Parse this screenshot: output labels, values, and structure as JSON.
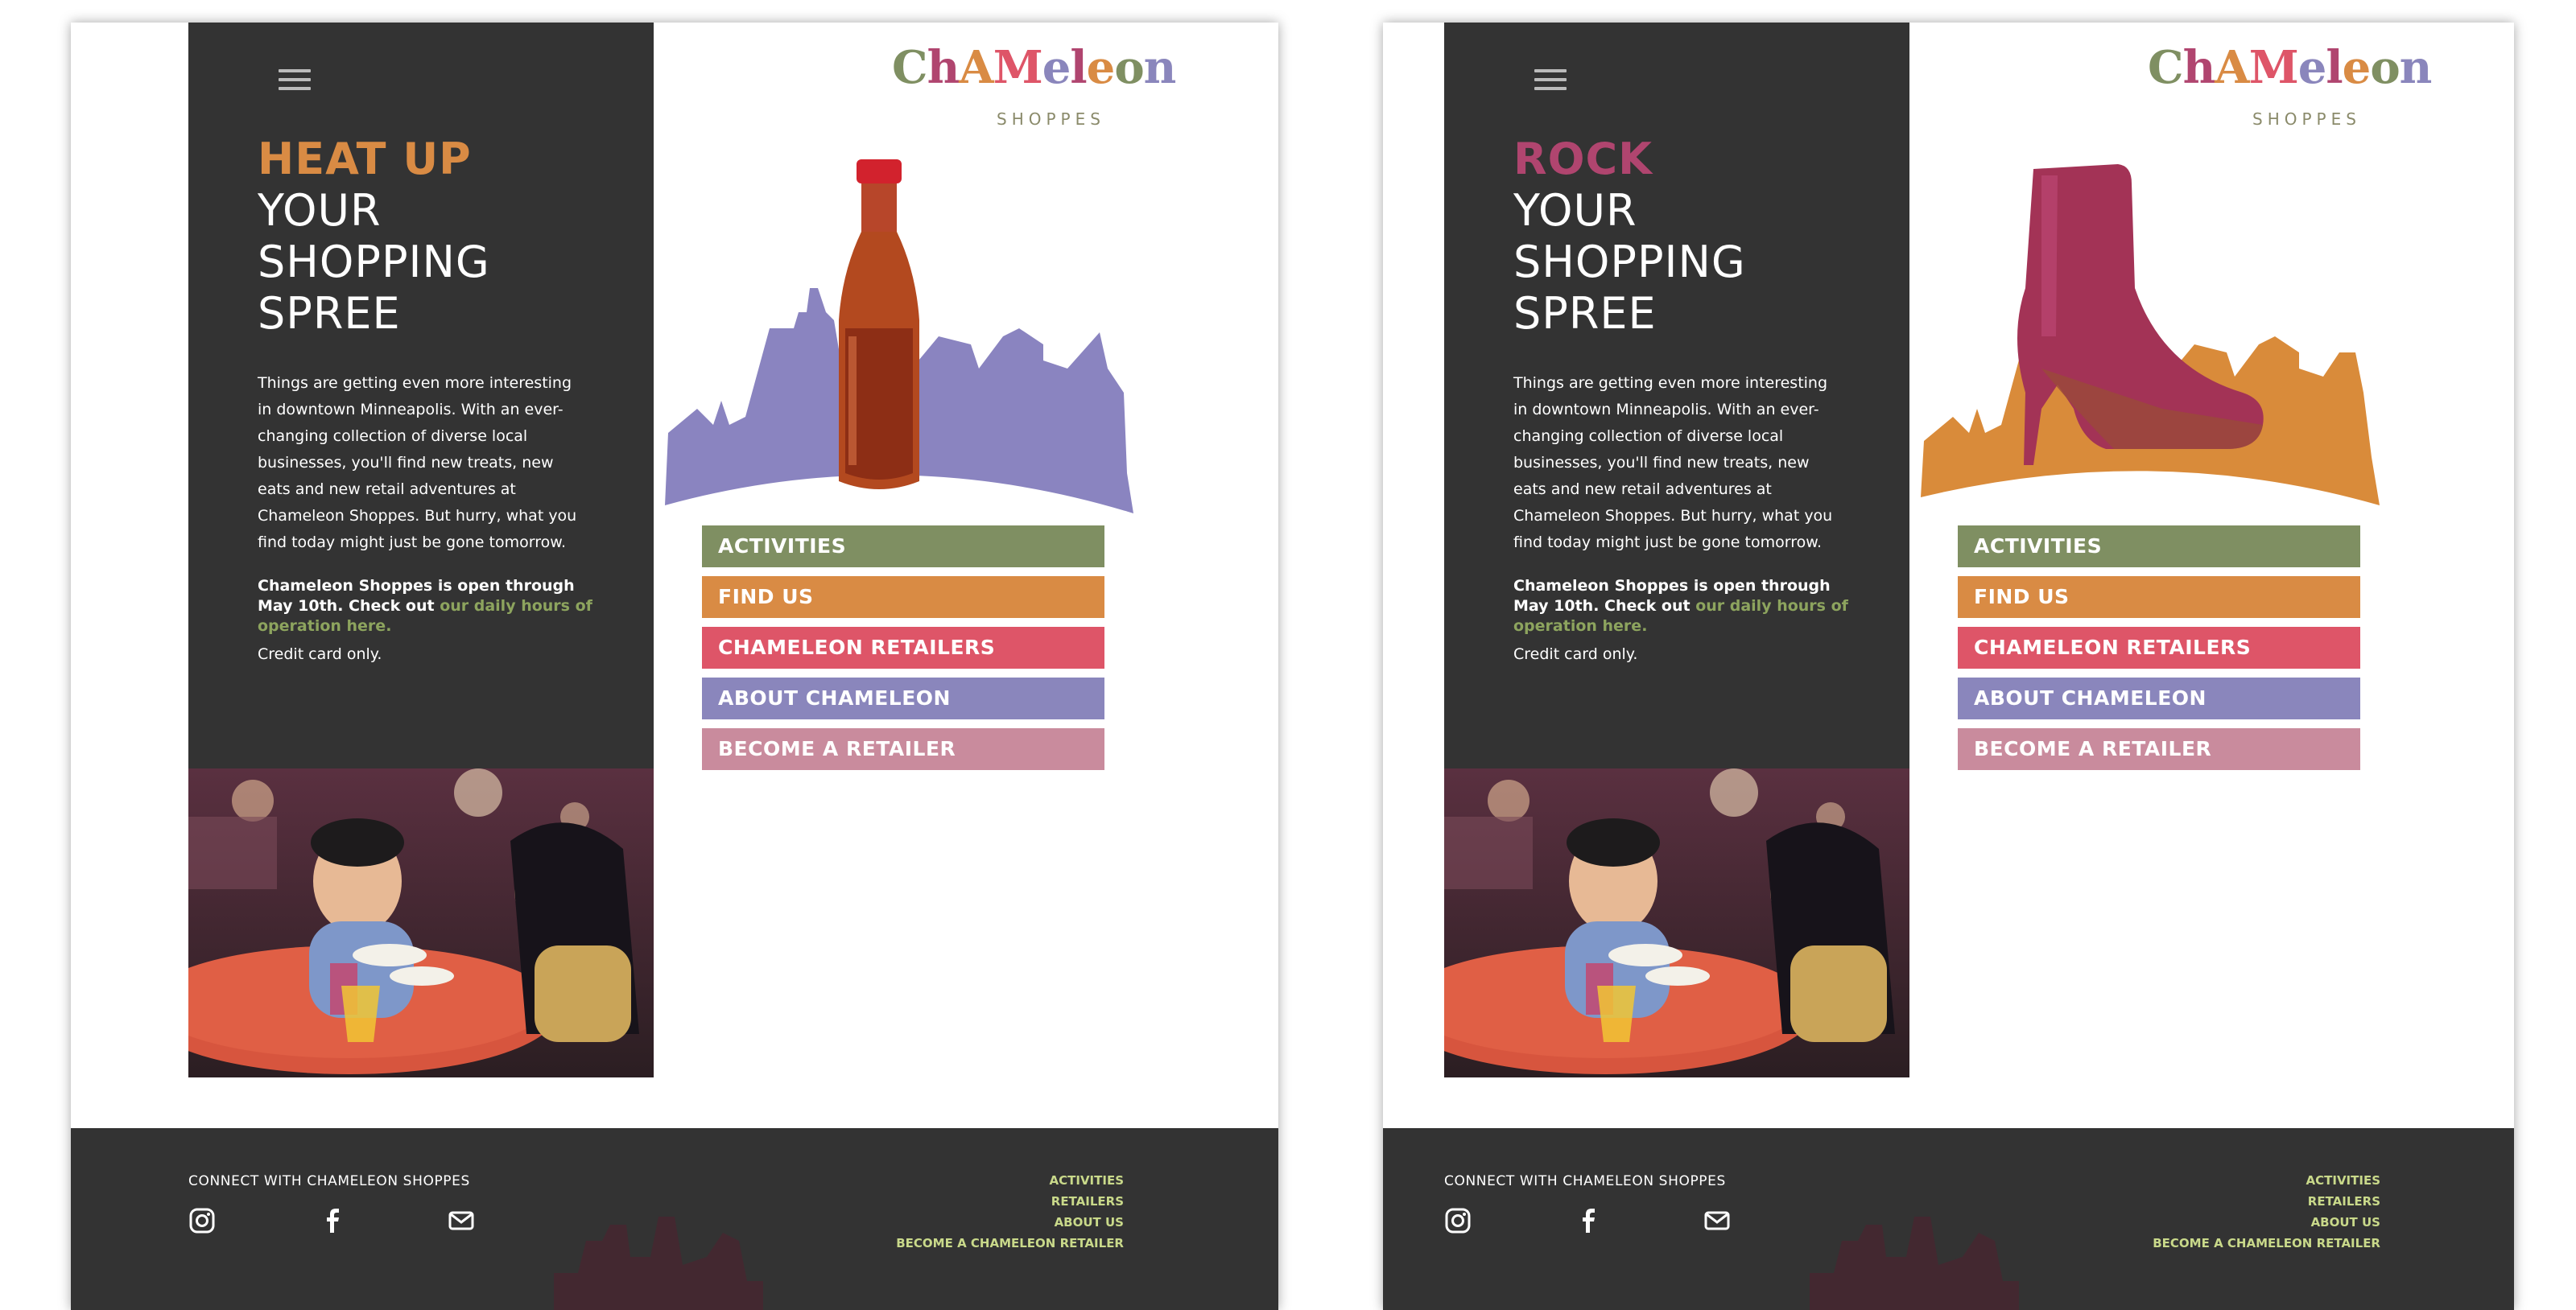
{
  "colors": {
    "dark": "#333333",
    "green": "#7f8f62",
    "orange": "#d98b44",
    "red": "#de5568",
    "purple": "#8a86bc",
    "pink": "#c98b9d",
    "link_green": "#8da45e",
    "footer_link": "#c9d98a",
    "heat_accent": "#d98b44",
    "rock_accent": "#b0456f",
    "skyline_purple": "#8a84c0",
    "skyline_orange": "#d98b3a"
  },
  "left": {
    "headline": {
      "accent": "HEAT UP",
      "line1": "YOUR",
      "line2": "SHOPPING",
      "line3": "SPREE"
    },
    "hero_icon": "hot-sauce-bottle"
  },
  "right": {
    "headline": {
      "accent": "ROCK",
      "line1": "YOUR",
      "line2": "SHOPPING",
      "line3": "SPREE"
    },
    "hero_icon": "ankle-boot"
  },
  "shared": {
    "menu_icon": "hamburger-icon",
    "body": "Things are getting even more interesting in downtown Minneapolis. With an ever-changing collection of diverse local businesses, you'll find new treats, new eats and new retail adventures at Chameleon Shoppes. But hurry, what you find today might just be gone tomorrow.",
    "hours_prefix": "Chameleon Shoppes is open through May 10th. Check out ",
    "hours_link": "our daily hours of operation here.",
    "credit": "Credit card only.",
    "logo": {
      "letters": [
        "C",
        "h",
        "A",
        "M",
        "e",
        "l",
        "e",
        "o",
        "n"
      ],
      "letter_colors": [
        "#7f8f62",
        "#b0456f",
        "#d98b44",
        "#de5568",
        "#8a86bc",
        "#b0456f",
        "#d98b44",
        "#7f8f62",
        "#8a86bc"
      ],
      "sub": "SHOPPES"
    },
    "nav": [
      {
        "label": "ACTIVITIES",
        "color": "#7f8f62"
      },
      {
        "label": "FIND US",
        "color": "#d98b44"
      },
      {
        "label": "CHAMELEON RETAILERS",
        "color": "#de5568"
      },
      {
        "label": "ABOUT CHAMELEON",
        "color": "#8a86bc"
      },
      {
        "label": "BECOME A RETAILER",
        "color": "#c98b9d"
      }
    ],
    "footer": {
      "title": "CONNECT WITH CHAMELEON SHOPPES",
      "social": [
        "instagram-icon",
        "facebook-icon",
        "mail-icon"
      ],
      "links": [
        "ACTIVITIES",
        "RETAILERS",
        "ABOUT US",
        "BECOME A CHAMELEON RETAILER"
      ]
    }
  }
}
